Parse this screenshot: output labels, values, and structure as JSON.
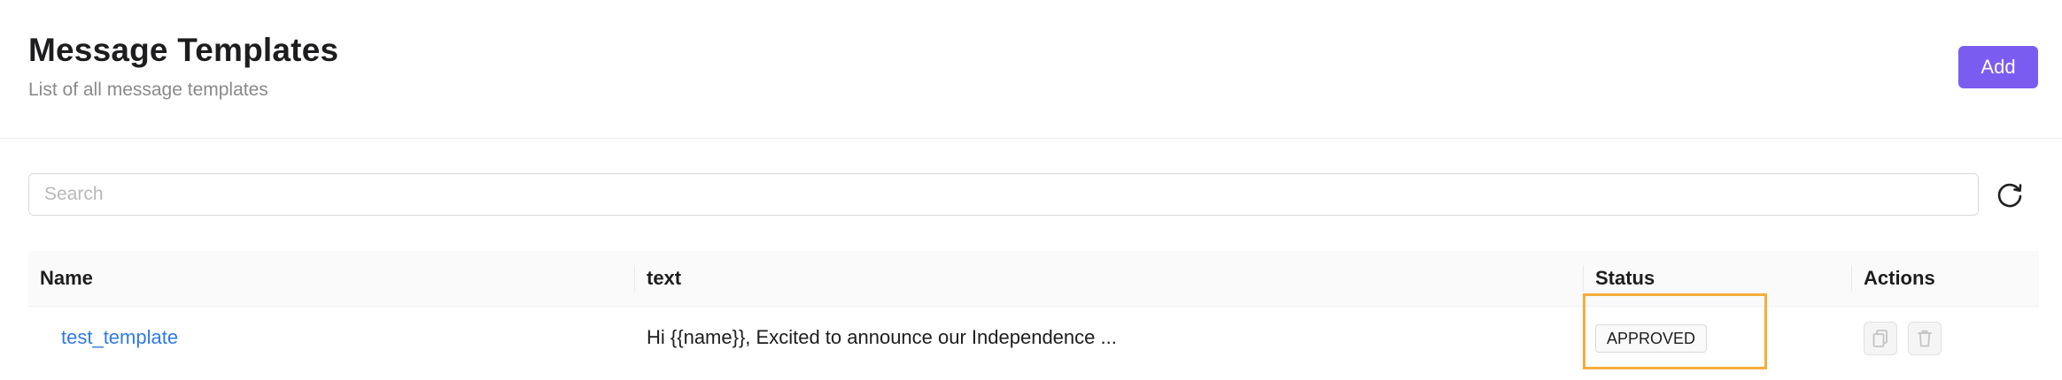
{
  "header": {
    "title": "Message Templates",
    "subtitle": "List of all message templates",
    "add_label": "Add"
  },
  "search": {
    "placeholder": "Search"
  },
  "table": {
    "columns": [
      "Name",
      "text",
      "Status",
      "Actions"
    ],
    "rows": [
      {
        "name": "test_template",
        "text": "Hi {{name}}, Excited to announce our Independence ...",
        "status": "APPROVED"
      }
    ]
  },
  "colors": {
    "accent": "#7b5cf0",
    "link": "#2f7ae5",
    "highlight": "#f5ad3b"
  },
  "icons": {
    "refresh": "refresh-icon",
    "copy": "copy-icon",
    "delete": "trash-icon"
  }
}
